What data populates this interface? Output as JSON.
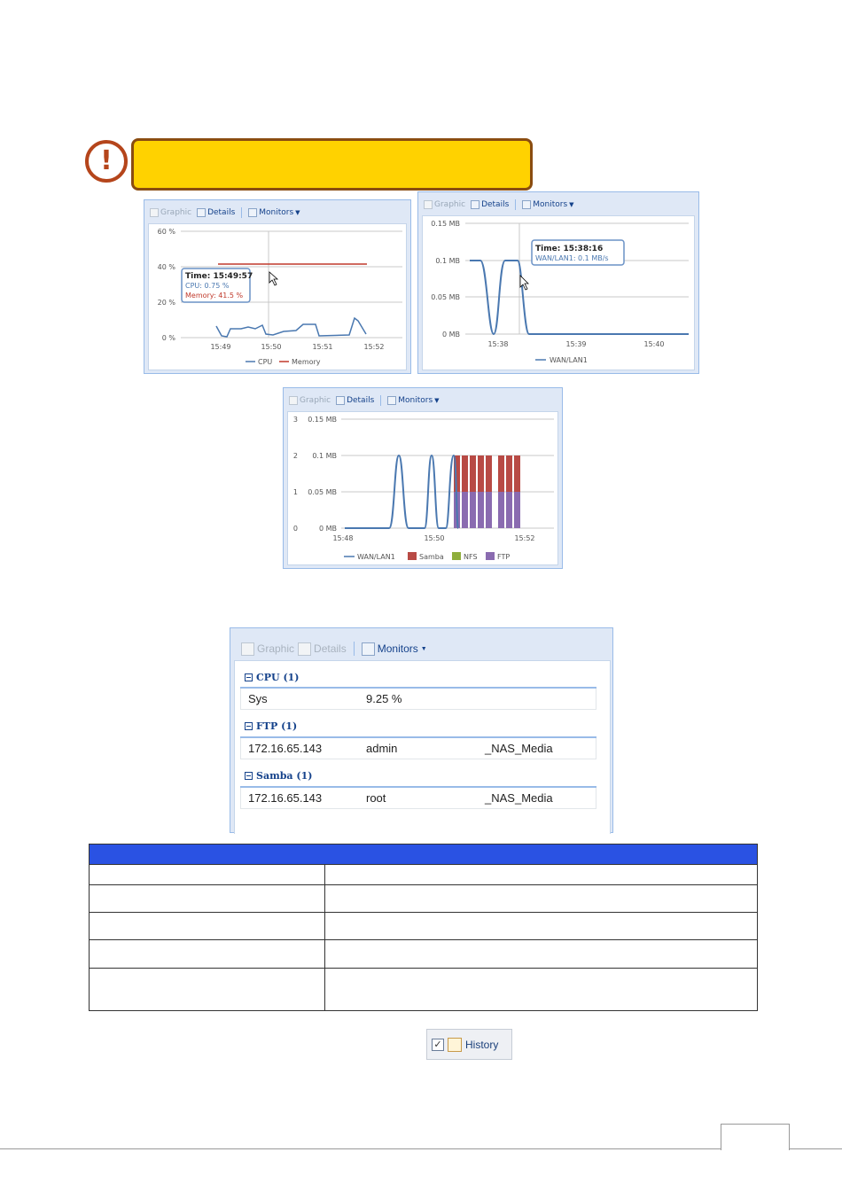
{
  "warning": {
    "icon": "exclamation-circle-icon",
    "text": ""
  },
  "toolbar": {
    "graphic": "Graphic",
    "details": "Details",
    "monitors": "Monitors"
  },
  "chart1": {
    "yticks": [
      "60 %",
      "40 %",
      "20 %",
      "0 %"
    ],
    "xticks": [
      "15:49",
      "15:50",
      "15:51",
      "15:52"
    ],
    "legend": [
      "CPU",
      "Memory"
    ],
    "tooltip": {
      "time": "Time: 15:49:57",
      "cpu": "CPU: 0.75 %",
      "mem": "Memory: 41.5 %"
    }
  },
  "chart2": {
    "yticks": [
      "0.15 MB",
      "0.1 MB",
      "0.05 MB",
      "0 MB"
    ],
    "xticks": [
      "15:38",
      "15:39",
      "15:40"
    ],
    "legend": [
      "WAN/LAN1"
    ],
    "tooltip": {
      "time": "Time: 15:38:16",
      "val": "WAN/LAN1: 0.1 MB/s"
    }
  },
  "chart3": {
    "yticks_left": [
      "3",
      "2",
      "1",
      "0"
    ],
    "yticks_right": [
      "0.15 MB",
      "0.1 MB",
      "0.05 MB",
      "0 MB"
    ],
    "xticks": [
      "15:48",
      "15:50",
      "15:52"
    ],
    "legend": [
      "WAN/LAN1",
      "Samba",
      "NFS",
      "FTP"
    ]
  },
  "chart_data": [
    {
      "type": "line",
      "x": [
        "15:49",
        "15:50",
        "15:51",
        "15:52"
      ],
      "series": [
        {
          "name": "CPU",
          "color": "#4a78b0"
        },
        {
          "name": "Memory",
          "color": "#c0392b",
          "values": [
            41.5,
            41.5,
            41.5,
            41.5
          ]
        }
      ],
      "ylim": [
        0,
        60
      ]
    },
    {
      "type": "line",
      "x": [
        "15:38",
        "15:39",
        "15:40"
      ],
      "series": [
        {
          "name": "WAN/LAN1",
          "color": "#4a78b0"
        }
      ],
      "ylim": [
        0,
        0.15
      ]
    },
    {
      "type": "bar",
      "x": [
        "15:48",
        "15:50",
        "15:52"
      ],
      "series": [
        {
          "name": "WAN/LAN1",
          "color": "#4a78b0"
        },
        {
          "name": "Samba",
          "color": "#b84a45"
        },
        {
          "name": "NFS",
          "color": "#8fae3c"
        },
        {
          "name": "FTP",
          "color": "#8a6bb0"
        }
      ],
      "ylim": [
        0,
        3
      ]
    }
  ],
  "details_panel": {
    "groups": [
      {
        "title": "CPU (1)",
        "cells": [
          "Sys",
          "9.25 %",
          ""
        ]
      },
      {
        "title": "FTP (1)",
        "cells": [
          "172.16.65.143",
          "admin",
          "_NAS_Media"
        ]
      },
      {
        "title": "Samba (1)",
        "cells": [
          "172.16.65.143",
          "root",
          "_NAS_Media"
        ]
      }
    ]
  },
  "history_button": {
    "label": "History",
    "checked": "✓"
  },
  "colors": {
    "table_header": "#2a52e3",
    "warning_bg": "#ffd200",
    "warning_border": "#8a4c10",
    "panel_blue": "#dfe8f6"
  }
}
